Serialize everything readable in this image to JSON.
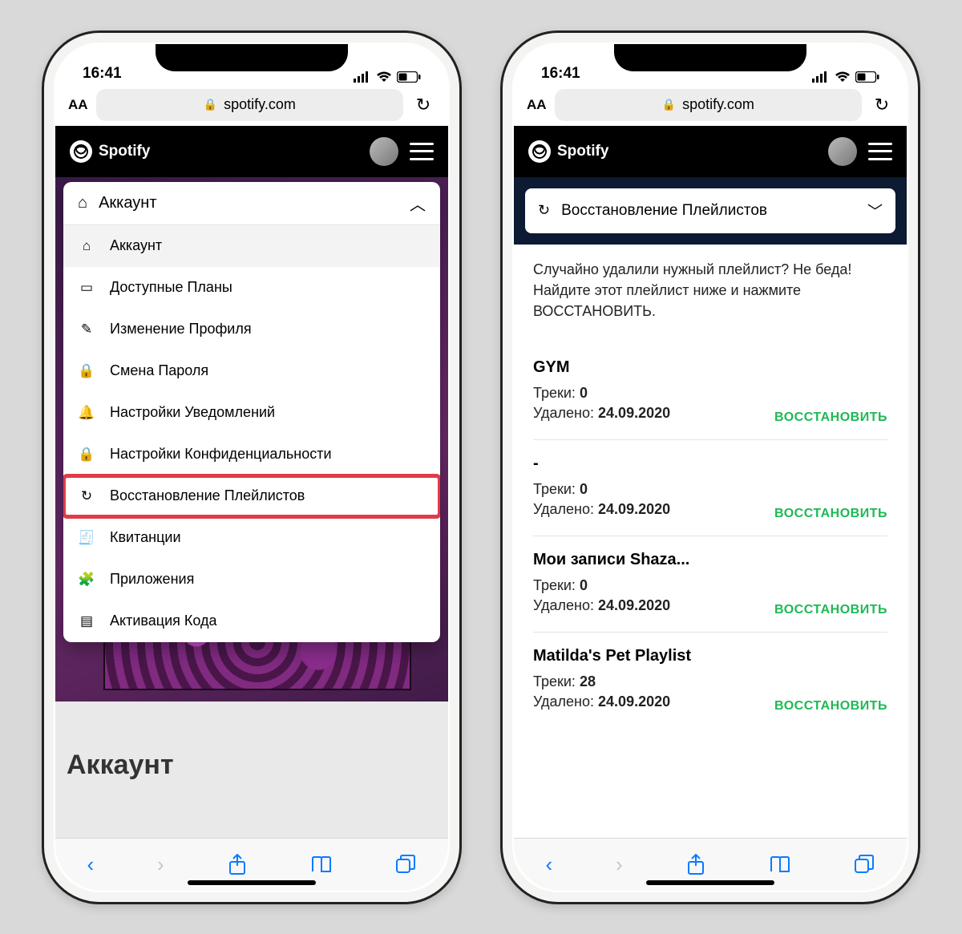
{
  "status": {
    "time": "16:41"
  },
  "browser": {
    "aa": "AA",
    "url": "spotify.com"
  },
  "spotify": {
    "brand": "Spotify"
  },
  "phone1": {
    "dropdown_header": "Аккаунт",
    "items": [
      {
        "label": "Аккаунт",
        "icon": "home"
      },
      {
        "label": "Доступные Планы",
        "icon": "card"
      },
      {
        "label": "Изменение Профиля",
        "icon": "pencil"
      },
      {
        "label": "Смена Пароля",
        "icon": "lock"
      },
      {
        "label": "Настройки Уведомлений",
        "icon": "bell"
      },
      {
        "label": "Настройки Конфиденциальности",
        "icon": "lock"
      },
      {
        "label": "Восстановление Плейлистов",
        "icon": "restore",
        "highlight": true
      },
      {
        "label": "Квитанции",
        "icon": "receipt"
      },
      {
        "label": "Приложения",
        "icon": "puzzle"
      },
      {
        "label": "Активация Кода",
        "icon": "code"
      }
    ],
    "page_heading": "Аккаунт"
  },
  "phone2": {
    "section_title": "Восстановление Плейлистов",
    "intro": "Случайно удалили нужный плейлист? Не беда! Найдите этот плейлист ниже и нажмите ВОССТАНОВИТЬ.",
    "tracks_label": "Треки:",
    "deleted_label": "Удалено:",
    "restore_label": "ВОССТАНОВИТЬ",
    "playlists": [
      {
        "name": "GYM",
        "tracks": "0",
        "deleted": "24.09.2020"
      },
      {
        "name": "-",
        "tracks": "0",
        "deleted": "24.09.2020"
      },
      {
        "name": "Мои записи Shaza...",
        "tracks": "0",
        "deleted": "24.09.2020"
      },
      {
        "name": "Matilda's Pet Playlist",
        "tracks": "28",
        "deleted": "24.09.2020"
      }
    ]
  }
}
